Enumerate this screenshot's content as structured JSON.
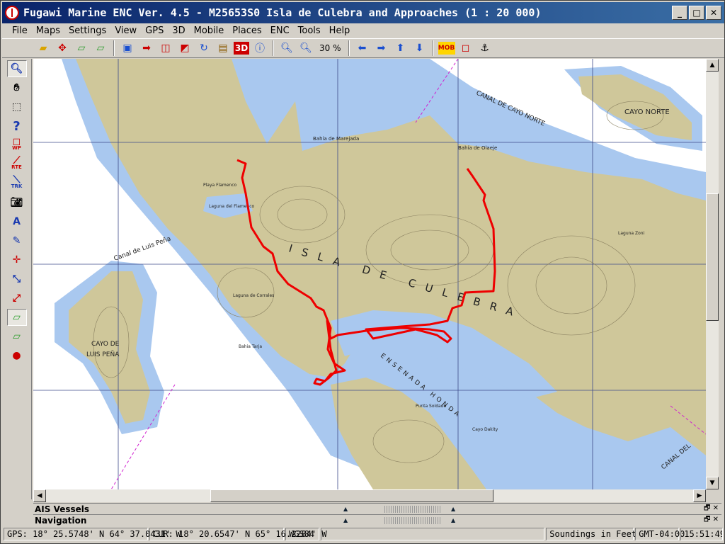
{
  "window": {
    "title": "Fugawi Marine ENC Ver. 4.5 - M25653S0  Isla de Culebra and Approaches  (1 : 20 000)"
  },
  "menu": [
    "File",
    "Maps",
    "Settings",
    "View",
    "GPS",
    "3D",
    "Mobile",
    "Places",
    "ENC",
    "Tools",
    "Help"
  ],
  "toolbar": {
    "zoom_label": "30 %",
    "mob_label": "MOB",
    "threed_label": "3D"
  },
  "lefttools": {
    "wp_label": "WP",
    "rte_label": "RTE",
    "trk_label": "TRK",
    "help_label": "?"
  },
  "map_labels": {
    "island_main": "ISLA DE CULEBRA",
    "island_north": "CAYO NORTE",
    "island_west_1": "CAYO DE",
    "island_west_2": "LUIS PEÑA",
    "channel_north": "CANAL DE CAYO NORTE",
    "channel_west": "Canal de Luis Peña",
    "channel_east": "CANAL DEL",
    "bay_honda": "ENSENADA HONDA",
    "lagoon_flamenco": "Laguna del Flamenco",
    "bay_marejada": "Bahía de Marejada",
    "bay_olaeje": "Bahía de Olaeje",
    "playa_flamenco": "Playa Flamenco",
    "lagoon_zoni": "Laguna Zoni",
    "lagoon_corrales": "Laguna de Corrales",
    "punta_soldado": "Punta Soldado",
    "bahia_tarja": "Bahia Tarja",
    "cayo_dakity": "Cayo Dakity"
  },
  "panels": {
    "ais": "AIS Vessels",
    "nav": "Navigation"
  },
  "status": {
    "gps": "GPS: 18° 25.5748' N 64° 37.0431' W",
    "cur": "CUR: 18° 20.6547' N 65° 16.2284' W",
    "datum": "WGS84",
    "soundings": "Soundings in Feet",
    "tz": "GMT-04:00",
    "time": "15:51:49..."
  },
  "colors": {
    "land": "#cfc79a",
    "shallow": "#a9c8ef",
    "track": "#ee0000"
  }
}
